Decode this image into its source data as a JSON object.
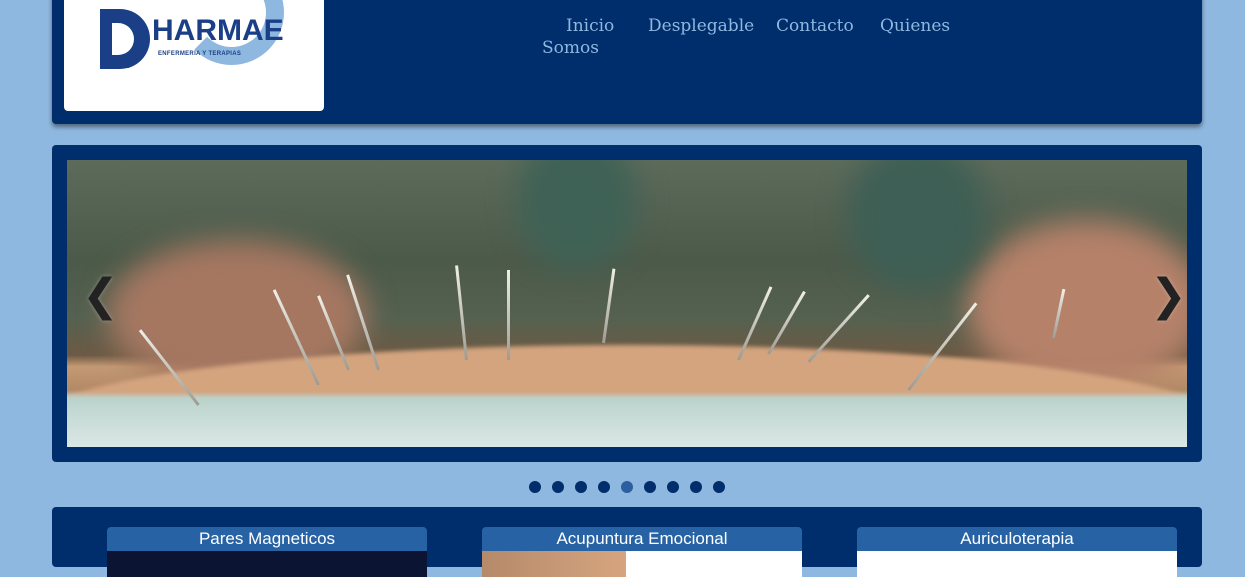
{
  "logo": {
    "name": "HARMAE",
    "tagline": "ENFERMERIA Y TERAPIAS"
  },
  "nav": {
    "items": [
      {
        "label": "Inicio"
      },
      {
        "label": "Desplegable"
      },
      {
        "label": "Contacto"
      },
      {
        "label": "Quienes"
      },
      {
        "label": "Somos"
      }
    ]
  },
  "slider": {
    "prev_symbol": "❮",
    "next_symbol": "❯",
    "dots_count": 9,
    "active_dot_number": 5
  },
  "cards": [
    {
      "title": "Pares Magneticos"
    },
    {
      "title": "Acupuntura Emocional"
    },
    {
      "title": "Auriculoterapia"
    }
  ],
  "colors": {
    "page_background": "#8fb8e0",
    "header_background": "#002d6b",
    "nav_text": "#8fb8e0",
    "card_header": "#2763a4",
    "logo_text": "#1a3f86"
  }
}
